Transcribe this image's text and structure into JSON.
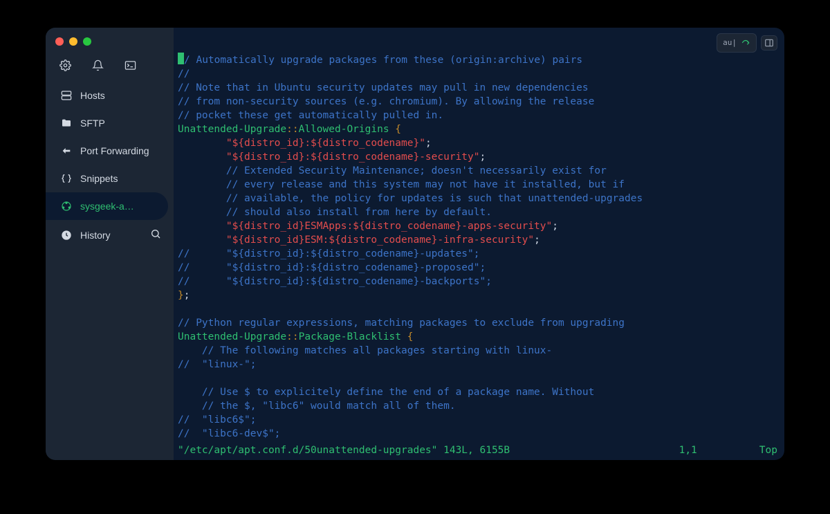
{
  "sidebar": {
    "items": [
      {
        "label": "Hosts"
      },
      {
        "label": "SFTP"
      },
      {
        "label": "Port Forwarding"
      },
      {
        "label": "Snippets"
      },
      {
        "label": "sysgeek-a…"
      },
      {
        "label": "History"
      }
    ]
  },
  "topbar": {
    "pill_text": "au|"
  },
  "editor": {
    "lines": [
      {
        "segments": [
          {
            "t": "CURSOR"
          },
          {
            "cls": "c-comment",
            "t": "/ Automatically upgrade packages from these (origin:archive) pairs"
          }
        ]
      },
      {
        "segments": [
          {
            "cls": "c-comment",
            "t": "//"
          }
        ]
      },
      {
        "segments": [
          {
            "cls": "c-comment",
            "t": "// Note that in Ubuntu security updates may pull in new dependencies"
          }
        ]
      },
      {
        "segments": [
          {
            "cls": "c-comment",
            "t": "// from non-security sources (e.g. chromium). By allowing the release"
          }
        ]
      },
      {
        "segments": [
          {
            "cls": "c-comment",
            "t": "// pocket these get automatically pulled in."
          }
        ]
      },
      {
        "segments": [
          {
            "cls": "c-key",
            "t": "Unattended-Upgrade"
          },
          {
            "cls": "c-delim",
            "t": "::"
          },
          {
            "cls": "c-key",
            "t": "Allowed-Origins"
          },
          {
            "t": " "
          },
          {
            "cls": "c-delim",
            "t": "{"
          }
        ]
      },
      {
        "segments": [
          {
            "t": "        "
          },
          {
            "cls": "c-str",
            "t": "\"${distro_id}:${distro_codename}\""
          },
          {
            "t": ";"
          }
        ]
      },
      {
        "segments": [
          {
            "t": "        "
          },
          {
            "cls": "c-str",
            "t": "\"${distro_id}:${distro_codename}-security\""
          },
          {
            "t": ";"
          }
        ]
      },
      {
        "segments": [
          {
            "t": "        "
          },
          {
            "cls": "c-comment",
            "t": "// Extended Security Maintenance; doesn't necessarily exist for"
          }
        ]
      },
      {
        "segments": [
          {
            "t": "        "
          },
          {
            "cls": "c-comment",
            "t": "// every release and this system may not have it installed, but if"
          }
        ]
      },
      {
        "segments": [
          {
            "t": "        "
          },
          {
            "cls": "c-comment",
            "t": "// available, the policy for updates is such that unattended-upgrades"
          }
        ]
      },
      {
        "segments": [
          {
            "t": "        "
          },
          {
            "cls": "c-comment",
            "t": "// should also install from here by default."
          }
        ]
      },
      {
        "segments": [
          {
            "t": "        "
          },
          {
            "cls": "c-str",
            "t": "\"${distro_id}ESMApps:${distro_codename}-apps-security\""
          },
          {
            "t": ";"
          }
        ]
      },
      {
        "segments": [
          {
            "t": "        "
          },
          {
            "cls": "c-str",
            "t": "\"${distro_id}ESM:${distro_codename}-infra-security\""
          },
          {
            "t": ";"
          }
        ]
      },
      {
        "segments": [
          {
            "cls": "c-comment",
            "t": "//      \"${distro_id}:${distro_codename}-updates\";"
          }
        ]
      },
      {
        "segments": [
          {
            "cls": "c-comment",
            "t": "//      \"${distro_id}:${distro_codename}-proposed\";"
          }
        ]
      },
      {
        "segments": [
          {
            "cls": "c-comment",
            "t": "//      \"${distro_id}:${distro_codename}-backports\";"
          }
        ]
      },
      {
        "segments": [
          {
            "cls": "c-delim",
            "t": "}"
          },
          {
            "t": ";"
          }
        ]
      },
      {
        "segments": []
      },
      {
        "segments": [
          {
            "cls": "c-comment",
            "t": "// Python regular expressions, matching packages to exclude from upgrading"
          }
        ]
      },
      {
        "segments": [
          {
            "cls": "c-key",
            "t": "Unattended-Upgrade"
          },
          {
            "cls": "c-delim",
            "t": "::"
          },
          {
            "cls": "c-key",
            "t": "Package-Blacklist"
          },
          {
            "t": " "
          },
          {
            "cls": "c-delim",
            "t": "{"
          }
        ]
      },
      {
        "segments": [
          {
            "t": "    "
          },
          {
            "cls": "c-comment",
            "t": "// The following matches all packages starting with linux-"
          }
        ]
      },
      {
        "segments": [
          {
            "cls": "c-comment",
            "t": "//  \"linux-\";"
          }
        ]
      },
      {
        "segments": []
      },
      {
        "segments": [
          {
            "t": "    "
          },
          {
            "cls": "c-comment",
            "t": "// Use $ to explicitely define the end of a package name. Without"
          }
        ]
      },
      {
        "segments": [
          {
            "t": "    "
          },
          {
            "cls": "c-comment",
            "t": "// the $, \"libc6\" would match all of them."
          }
        ]
      },
      {
        "segments": [
          {
            "cls": "c-comment",
            "t": "//  \"libc6$\";"
          }
        ]
      },
      {
        "segments": [
          {
            "cls": "c-comment",
            "t": "//  \"libc6-dev$\";"
          }
        ]
      }
    ]
  },
  "status": {
    "file": "\"/etc/apt/apt.conf.d/50unattended-upgrades\" 143L, 6155B",
    "pos": "1,1",
    "scroll": "Top"
  }
}
